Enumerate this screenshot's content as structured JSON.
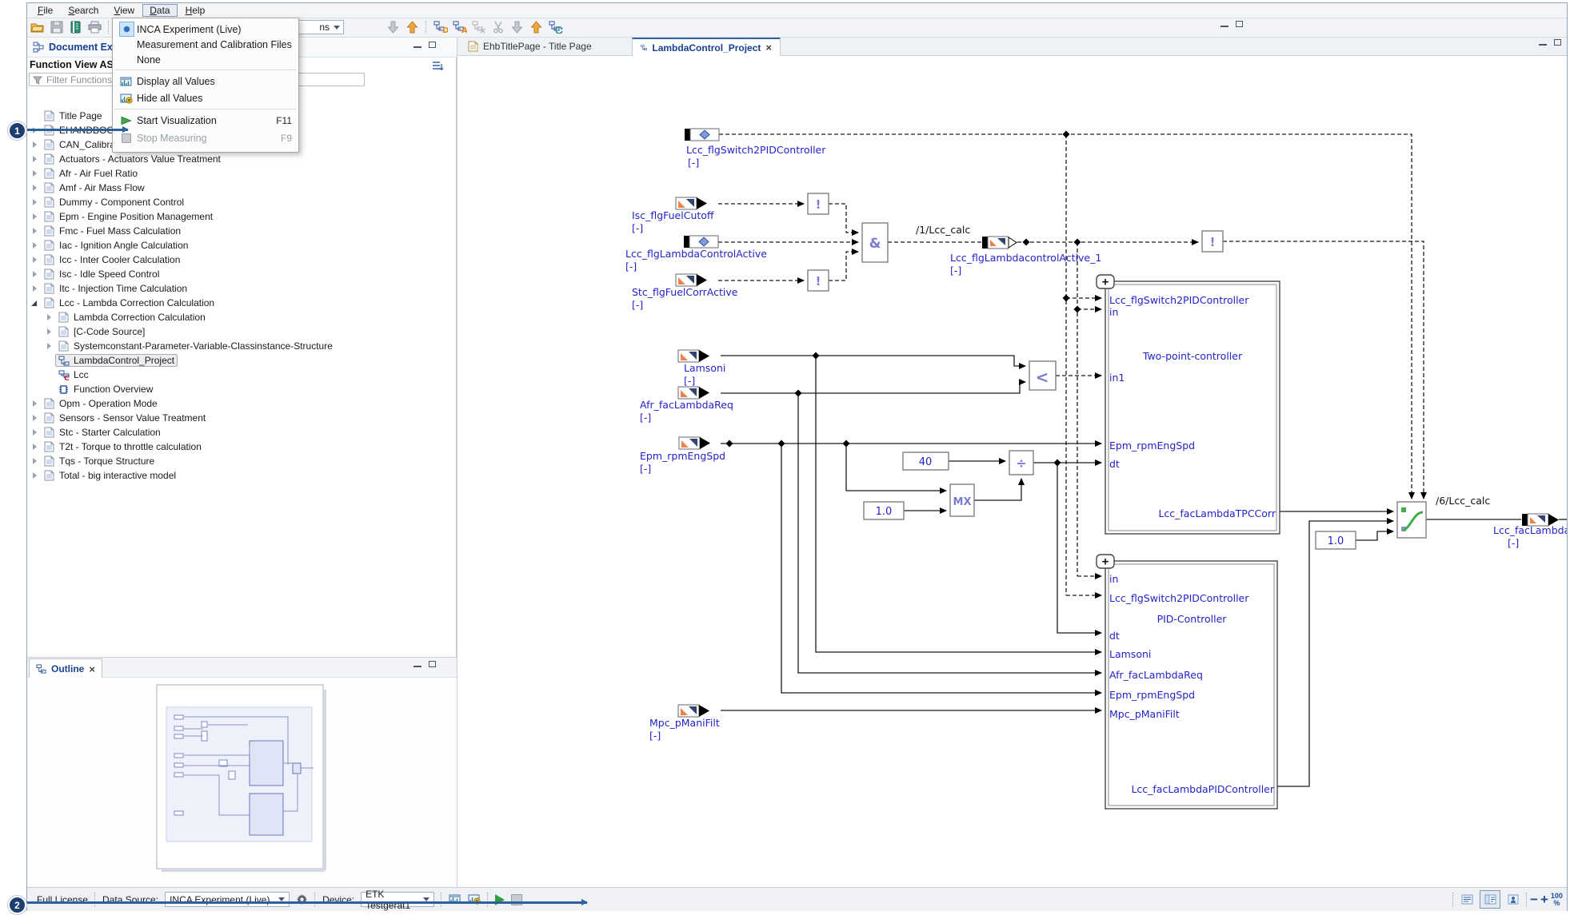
{
  "menu_bar": {
    "items": [
      "File",
      "Search",
      "View",
      "Data",
      "Help"
    ],
    "open_item": "Data"
  },
  "data_menu": {
    "items": [
      {
        "type": "item",
        "label": "INCA Experiment (Live)",
        "icon": "radio-selected",
        "shortcut": ""
      },
      {
        "type": "item",
        "label": "Measurement and Calibration Files",
        "icon": "",
        "shortcut": ""
      },
      {
        "type": "item",
        "label": "None",
        "icon": "",
        "shortcut": ""
      },
      {
        "type": "separator"
      },
      {
        "type": "item",
        "label": "Display all Values",
        "icon": "display-values",
        "shortcut": ""
      },
      {
        "type": "item",
        "label": "Hide all Values",
        "icon": "hide-values",
        "shortcut": ""
      },
      {
        "type": "separator"
      },
      {
        "type": "item",
        "label": "Start Visualization",
        "icon": "start-visualization",
        "shortcut": "F11"
      },
      {
        "type": "item",
        "label": "Stop Measuring",
        "icon": "stop-measuring",
        "shortcut": "F9",
        "disabled": true
      }
    ]
  },
  "toolbar": {
    "combo_label": "ns",
    "left_icons": [
      "open-file-icon",
      "save-icon",
      "library-icon",
      "print-icon",
      "separator",
      "back-icon"
    ],
    "right_icons": [
      "nav-down-icon",
      "nav-up-icon",
      "separator",
      "diagram-d-icon",
      "diagram-a-icon",
      "diagram-x-icon",
      "cut-icon",
      "nav-down2-icon",
      "nav-up2-icon",
      "diagram-refresh-icon"
    ]
  },
  "explorer": {
    "title": "Document Explorer",
    "view_label": "Function View ASCET",
    "filter_placeholder": "Filter Functions",
    "tree": [
      {
        "label": "Title Page",
        "icon": "doc",
        "indent": 0,
        "expander": ""
      },
      {
        "label": "EHANDBOOK",
        "icon": "doc",
        "indent": 0,
        "expander": "collapsed"
      },
      {
        "label": "CAN_Calibrati",
        "icon": "doc",
        "indent": 0,
        "expander": "collapsed"
      },
      {
        "label": "Actuators - Actuators Value Treatment",
        "icon": "doc",
        "indent": 0,
        "expander": "collapsed"
      },
      {
        "label": "Afr - Air Fuel Ratio",
        "icon": "doc",
        "indent": 0,
        "expander": "collapsed"
      },
      {
        "label": "Amf - Air Mass Flow",
        "icon": "doc",
        "indent": 0,
        "expander": "collapsed"
      },
      {
        "label": "Dummy - Component Control",
        "icon": "doc",
        "indent": 0,
        "expander": "collapsed"
      },
      {
        "label": "Epm - Engine Position Management",
        "icon": "doc",
        "indent": 0,
        "expander": "collapsed"
      },
      {
        "label": "Fmc - Fuel Mass Calculation",
        "icon": "doc",
        "indent": 0,
        "expander": "collapsed"
      },
      {
        "label": "Iac - Ignition Angle Calculation",
        "icon": "doc",
        "indent": 0,
        "expander": "collapsed"
      },
      {
        "label": "Icc - Inter Cooler Calculation",
        "icon": "doc",
        "indent": 0,
        "expander": "collapsed"
      },
      {
        "label": "Isc - Idle Speed Control",
        "icon": "doc",
        "indent": 0,
        "expander": "collapsed"
      },
      {
        "label": "Itc - Injection Time Calculation",
        "icon": "doc",
        "indent": 0,
        "expander": "collapsed"
      },
      {
        "label": "Lcc - Lambda Correction Calculation",
        "icon": "doc",
        "indent": 0,
        "expander": "expanded"
      },
      {
        "label": "Lambda Correction Calculation",
        "icon": "doc",
        "indent": 1,
        "expander": "collapsed"
      },
      {
        "label": "[C-Code Source]",
        "icon": "doc",
        "indent": 1,
        "expander": "collapsed"
      },
      {
        "label": "Systemconstant-Parameter-Variable-Classinstance-Structure",
        "icon": "doc",
        "indent": 1,
        "expander": "collapsed"
      },
      {
        "label": "LambdaControl_Project",
        "icon": "diagram",
        "indent": 1,
        "expander": "",
        "selected": true
      },
      {
        "label": "Lcc",
        "icon": "diagram-c",
        "indent": 1,
        "expander": ""
      },
      {
        "label": "Function Overview",
        "icon": "chip",
        "indent": 1,
        "expander": ""
      },
      {
        "label": "Opm - Operation Mode",
        "icon": "doc",
        "indent": 0,
        "expander": "collapsed"
      },
      {
        "label": "Sensors - Sensor Value Treatment",
        "icon": "doc",
        "indent": 0,
        "expander": "collapsed"
      },
      {
        "label": "Stc - Starter Calculation",
        "icon": "doc",
        "indent": 0,
        "expander": "collapsed"
      },
      {
        "label": "T2t - Torque to throttle calculation",
        "icon": "doc",
        "indent": 0,
        "expander": "collapsed"
      },
      {
        "label": "Tqs - Torque Structure",
        "icon": "doc",
        "indent": 0,
        "expander": "collapsed"
      },
      {
        "label": "Total - big interactive model",
        "icon": "doc",
        "indent": 0,
        "expander": "collapsed"
      }
    ]
  },
  "tabs": [
    {
      "label": "EhbTitlePage - Title Page",
      "icon": "doc",
      "active": false,
      "close": ""
    },
    {
      "label": "LambdaControl_Project",
      "icon": "diagram",
      "active": true,
      "close": "×"
    }
  ],
  "outline": {
    "title": "Outline",
    "close": "×"
  },
  "statusbar": {
    "license": "Full License",
    "data_source_label": "Data Source:",
    "data_source_value": "INCA Experiment (Live)",
    "device_label": "Device:",
    "device_value": "ETK Testgerät1",
    "zoom_value": "100",
    "zoom_unit": "%",
    "minus": "−",
    "plus": "+"
  },
  "callouts": [
    {
      "number": "1"
    },
    {
      "number": "2"
    }
  ],
  "diagram": {
    "labels": {
      "unit": "[-]",
      "top": "Lcc_flgSwitch2PIDController",
      "isc": "Isc_flgFuelCutoff",
      "active": "Lcc_flgLambdaControlActive",
      "stc": "Stc_flgFuelCorrActive",
      "calc1": "/1/Lcc_calc",
      "out1": "Lcc_flgLambdacontrolActive_1",
      "lamsoni": "Lamsoni",
      "afr": "Afr_facLambdaReq",
      "epm": "Epm_rpmEngSpd",
      "mpc": "Mpc_pManiFilt",
      "c40": "40",
      "c10": "1.0",
      "in": "in",
      "in1": "in1",
      "dt": "dt",
      "tpc_title": "Two-point-controller",
      "tpc_top": "Lcc_flgSwitch2PIDController",
      "tpc_out": "Lcc_facLambdaTPCCorr",
      "pid_title": "PID-Controller",
      "pid_sw": "Lcc_flgSwitch2PIDController",
      "pid_out": "Lcc_facLambdaPIDController",
      "calc6": "/6/Lcc_calc",
      "corr": "Lcc_facLambdaCorr"
    },
    "glyphs": {
      "and": "&",
      "not": "!",
      "lt": "<",
      "div": "÷",
      "mx": "MX",
      "plus": "+"
    }
  }
}
